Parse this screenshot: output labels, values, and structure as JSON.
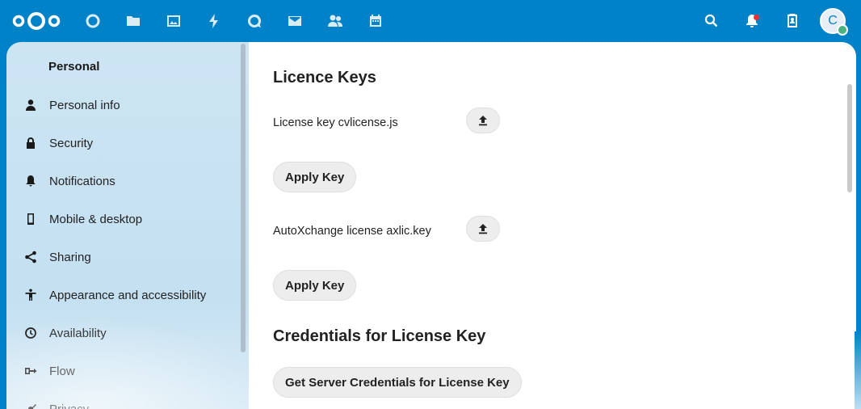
{
  "header": {
    "apps": [
      {
        "name": "dashboard-icon"
      },
      {
        "name": "files-icon"
      },
      {
        "name": "photos-icon"
      },
      {
        "name": "activity-icon"
      },
      {
        "name": "talk-icon"
      },
      {
        "name": "mail-icon"
      },
      {
        "name": "contacts-icon"
      },
      {
        "name": "calendar-icon"
      }
    ],
    "avatar_initial": "C"
  },
  "sidebar": {
    "caption": "Personal",
    "items": [
      {
        "label": "Personal info",
        "icon": "user-icon"
      },
      {
        "label": "Security",
        "icon": "lock-icon"
      },
      {
        "label": "Notifications",
        "icon": "bell-icon"
      },
      {
        "label": "Mobile & desktop",
        "icon": "phone-icon"
      },
      {
        "label": "Sharing",
        "icon": "share-icon"
      },
      {
        "label": "Appearance and accessibility",
        "icon": "accessibility-icon"
      },
      {
        "label": "Availability",
        "icon": "clock-icon"
      },
      {
        "label": "Flow",
        "icon": "flow-icon"
      },
      {
        "label": "Privacy",
        "icon": "privacy-icon"
      }
    ]
  },
  "main": {
    "licence_heading": "Licence Keys",
    "license1_label": "License key cvlicense.js",
    "apply1_label": "Apply Key",
    "license2_label": "AutoXchange license axlic.key",
    "apply2_label": "Apply Key",
    "credentials_heading": "Credentials for License Key",
    "credentials_button": "Get Server Credentials for License Key"
  },
  "colors": {
    "brand": "#0082c9",
    "online_status": "#49b382",
    "notification_dot": "#e9322d"
  }
}
